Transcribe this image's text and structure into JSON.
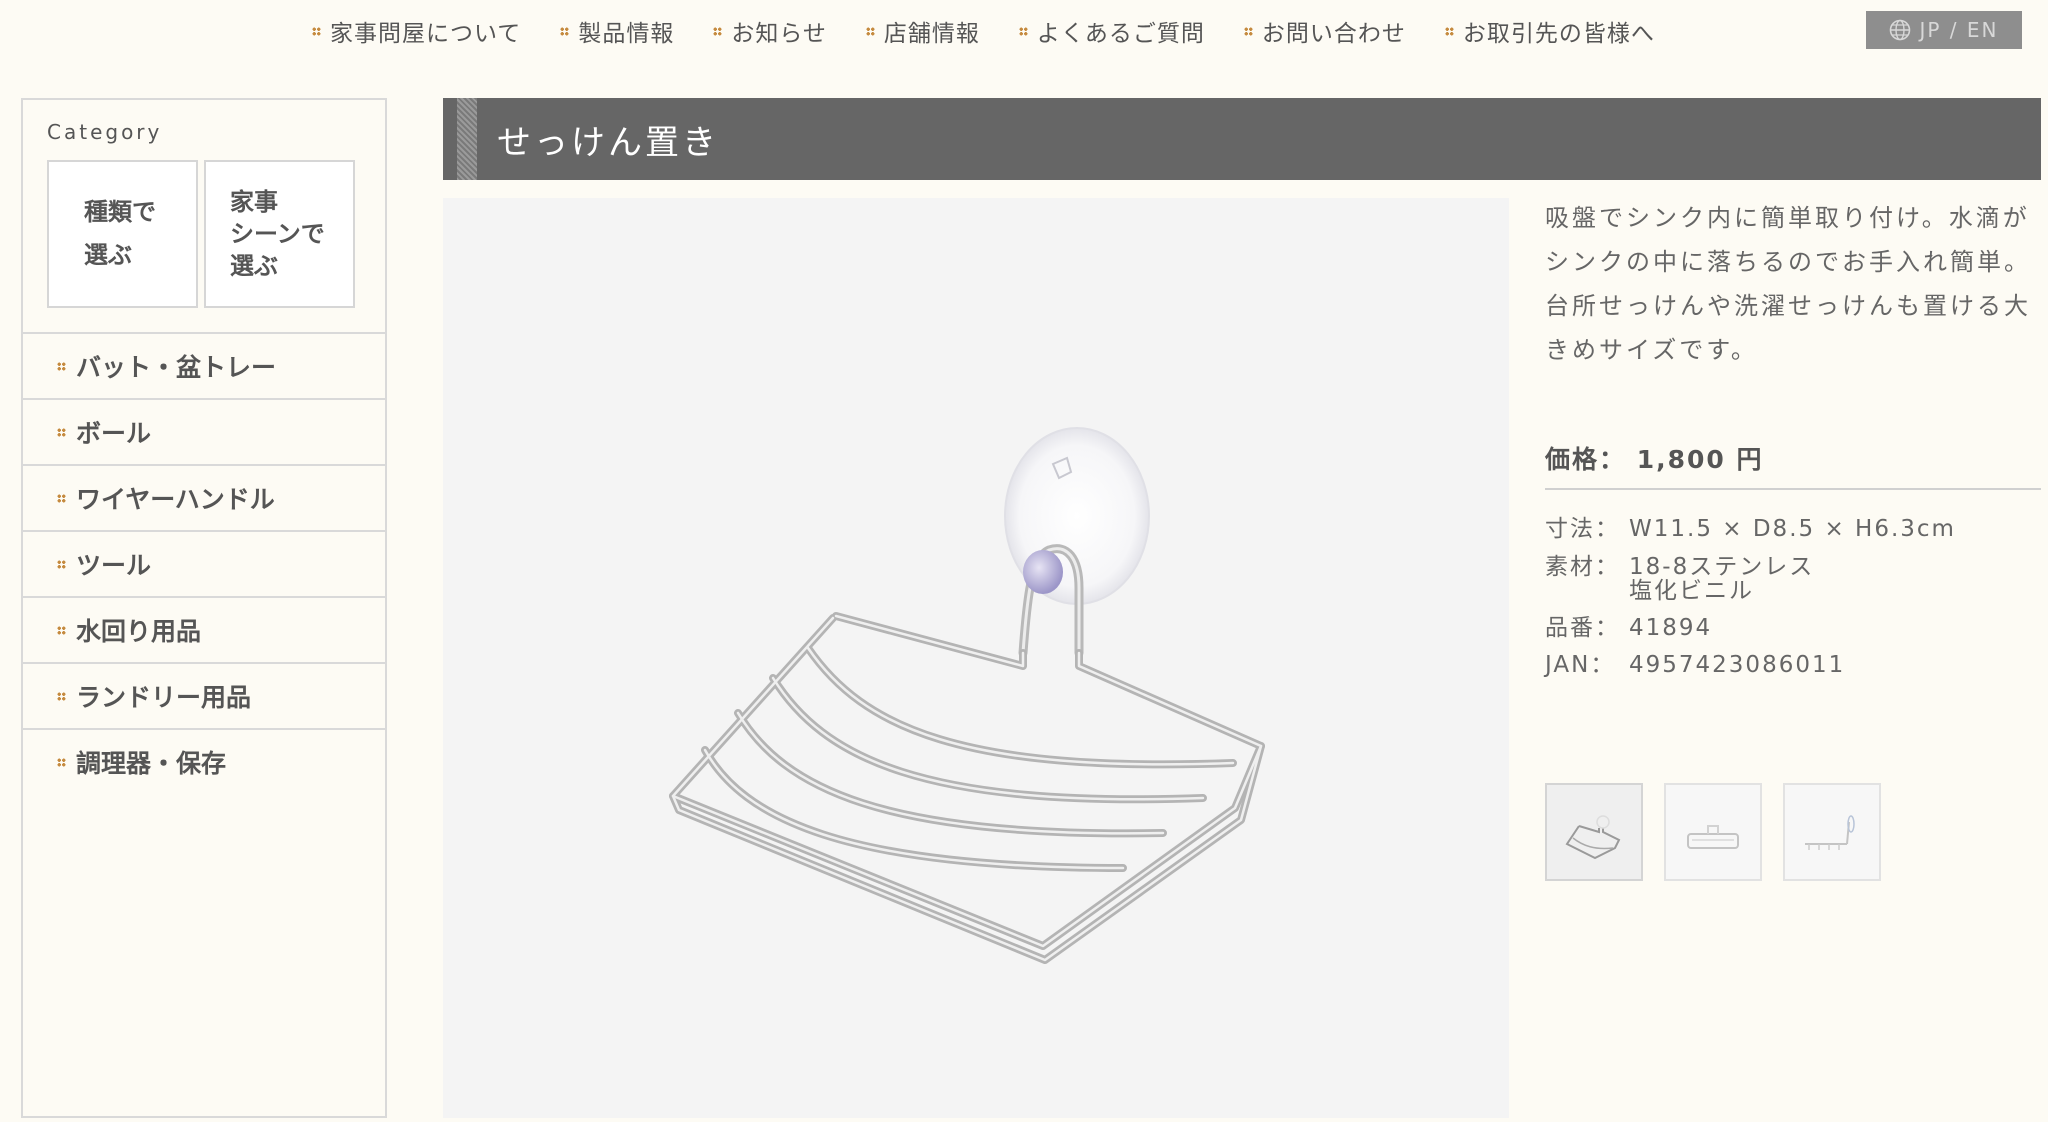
{
  "nav": {
    "items": [
      {
        "label": "家事問屋について"
      },
      {
        "label": "製品情報"
      },
      {
        "label": "お知らせ"
      },
      {
        "label": "店舗情報"
      },
      {
        "label": "よくあるご質問"
      },
      {
        "label": "お問い合わせ"
      },
      {
        "label": "お取引先の皆様へ"
      }
    ],
    "lang_label": "JP / EN",
    "lang_icon": "globe-icon"
  },
  "sidebar": {
    "title": "Category",
    "boxes": [
      {
        "label": "種類で\n選ぶ"
      },
      {
        "label": "家事\nシーンで\n選ぶ"
      }
    ],
    "items": [
      {
        "label": "バット・盆トレー"
      },
      {
        "label": "ボール"
      },
      {
        "label": "ワイヤーハンドル"
      },
      {
        "label": "ツール"
      },
      {
        "label": "水回り用品"
      },
      {
        "label": "ランドリー用品"
      },
      {
        "label": "調理器・保存"
      }
    ]
  },
  "product": {
    "title": "せっけん置き",
    "description": "吸盤でシンク内に簡単取り付け。水滴がシンクの中に落ちるのでお手入れ簡単。台所せっけんや洗濯せっけんも置ける大きめサイズです。",
    "price_label": "価格：",
    "price_value": "1,800",
    "price_unit": "円",
    "specs": [
      {
        "key": "寸法：",
        "value": "W11.5 × D8.5 × H6.3cm"
      },
      {
        "key": "素材：",
        "value": "18-8ステンレス\n塩化ビニル"
      },
      {
        "key": "品番：",
        "value": "41894"
      },
      {
        "key": "JAN：",
        "value": "4957423086011"
      }
    ],
    "thumbnail_count": 3
  },
  "colors": {
    "background": "#fdfbf4",
    "header_bar": "#666666",
    "accent_dots": "#c58a3e",
    "lang_button": "#8e8e8e"
  }
}
